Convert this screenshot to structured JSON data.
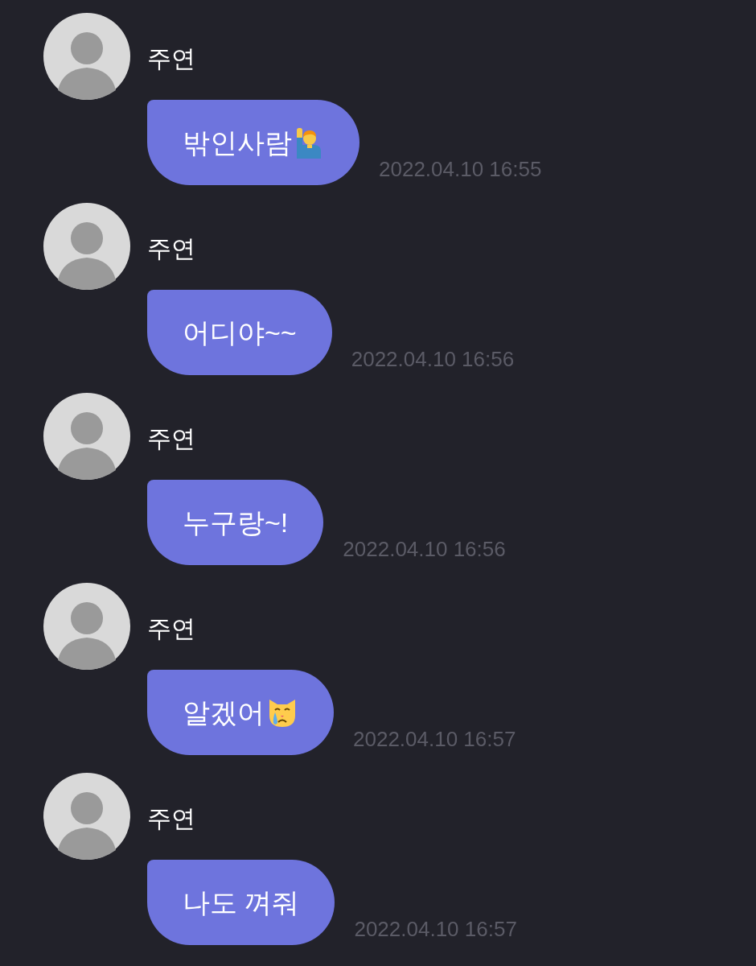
{
  "messages": [
    {
      "kind": "hand",
      "sender": "주연",
      "text": "밖인사람",
      "time": "2022.04.10 16:55"
    },
    {
      "kind": "plain",
      "sender": "주연",
      "text": "어디야~~",
      "time": "2022.04.10 16:56"
    },
    {
      "kind": "plain",
      "sender": "주연",
      "text": "누구랑~!",
      "time": "2022.04.10 16:56"
    },
    {
      "kind": "cat",
      "sender": "주연",
      "text": "알겠어",
      "time": "2022.04.10 16:57"
    },
    {
      "kind": "plain",
      "sender": "주연",
      "text": "나도 껴줘",
      "time": "2022.04.10 16:57"
    }
  ]
}
